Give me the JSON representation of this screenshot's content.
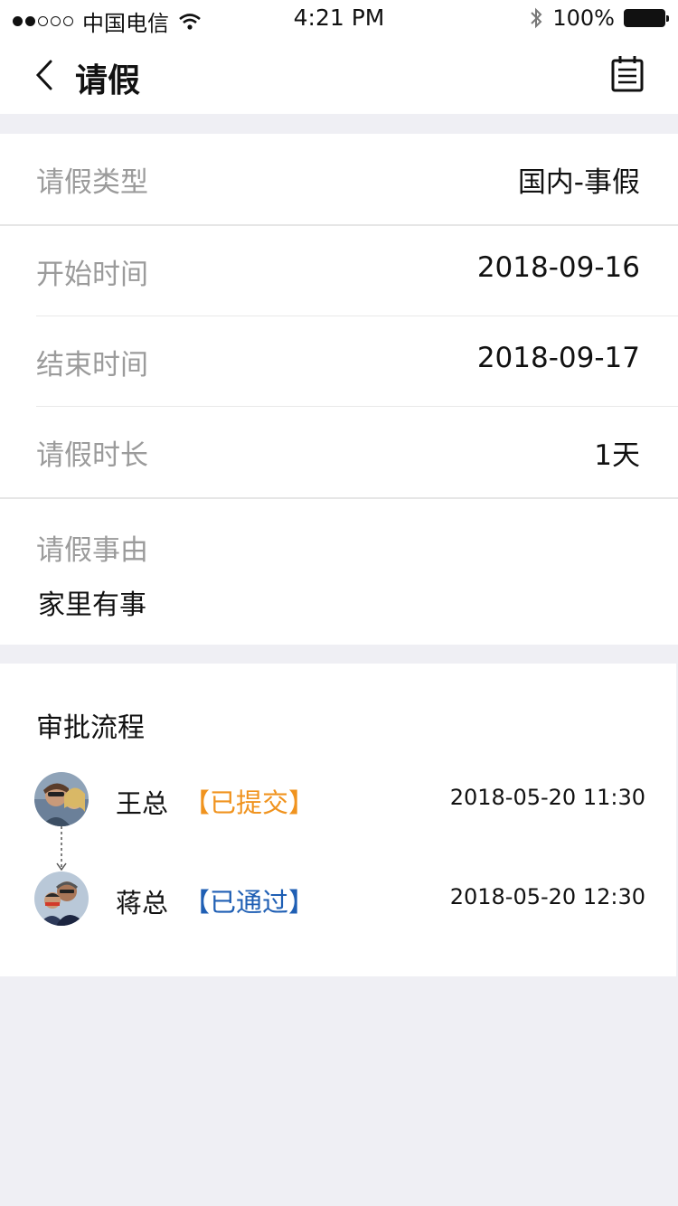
{
  "status_bar": {
    "carrier": "中国电信",
    "time": "4:21 PM",
    "battery": "100%"
  },
  "nav": {
    "title": "请假"
  },
  "form": {
    "rows": [
      {
        "label": "请假类型",
        "value": "国内-事假"
      },
      {
        "label": "开始时间",
        "value": "2018-09-16"
      },
      {
        "label": "结束时间",
        "value": "2018-09-17"
      },
      {
        "label": "请假时长",
        "value": "1天"
      }
    ],
    "reason_label": "请假事由",
    "reason_value": "家里有事"
  },
  "approval": {
    "title": "审批流程",
    "steps": [
      {
        "name": "王总",
        "status": "【已提交】",
        "time": "2018-05-20 11:30",
        "status_color": "#f0931e"
      },
      {
        "name": "蒋总",
        "status": "【已通过】",
        "time": "2018-05-20 12:30",
        "status_color": "#1f5fb4"
      }
    ]
  },
  "icons": {
    "back": "chevron-left-icon",
    "calendar": "calendar-icon",
    "wifi": "wifi-icon",
    "bluetooth": "bluetooth-icon",
    "battery": "battery-icon"
  }
}
